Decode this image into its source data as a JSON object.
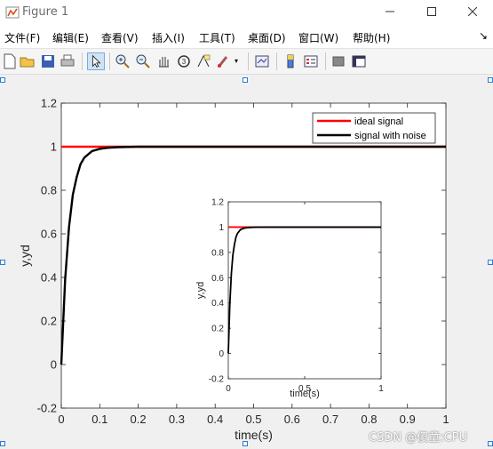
{
  "window": {
    "title": "Figure 1"
  },
  "menu": [
    {
      "label": "文件(F)"
    },
    {
      "label": "编辑(E)"
    },
    {
      "label": "查看(V)"
    },
    {
      "label": "插入(I)"
    },
    {
      "label": "工具(T)"
    },
    {
      "label": "桌面(D)"
    },
    {
      "label": "窗口(W)"
    },
    {
      "label": "帮助(H)"
    }
  ],
  "toolbar_icons": [
    "new-figure-icon",
    "open-file-icon",
    "save-icon",
    "print-icon",
    "select-pointer-icon",
    "zoom-in-icon",
    "zoom-out-icon",
    "pan-hand-icon",
    "rotate-3d-icon",
    "data-cursor-icon",
    "brush-icon",
    "link-plot-icon",
    "colorbar-icon",
    "legend-icon",
    "hide-plot-tools-icon",
    "show-plot-tools-icon"
  ],
  "chart_data": [
    {
      "type": "line",
      "xlabel": "time(s)",
      "ylabel": "y,yd",
      "xlim": [
        0,
        1
      ],
      "ylim": [
        -0.2,
        1.2
      ],
      "xticks": [
        "0",
        "0.1",
        "0.2",
        "0.3",
        "0.4",
        "0.5",
        "0.6",
        "0.7",
        "0.8",
        "0.9",
        "1"
      ],
      "yticks": [
        "-0.2",
        "0",
        "0.2",
        "0.4",
        "0.6",
        "0.8",
        "1",
        "1.2"
      ],
      "grid": false,
      "legend_position": "top-right",
      "series": [
        {
          "name": "ideal signal",
          "color": "#ff0000",
          "x": [
            0,
            1
          ],
          "y": [
            1,
            1
          ]
        },
        {
          "name": "signal with noise",
          "color": "#000000",
          "x": [
            0,
            0.01,
            0.02,
            0.03,
            0.04,
            0.05,
            0.06,
            0.08,
            0.1,
            0.12,
            0.15,
            0.2,
            0.3,
            0.5,
            1
          ],
          "y": [
            0,
            0.39,
            0.63,
            0.78,
            0.86,
            0.92,
            0.95,
            0.98,
            0.99,
            0.995,
            0.998,
            1,
            1,
            1,
            1
          ]
        }
      ]
    },
    {
      "type": "line",
      "xlabel": "time(s)",
      "ylabel": "y,yd",
      "xlim": [
        0,
        1
      ],
      "ylim": [
        -0.2,
        1.2
      ],
      "xticks": [
        "0",
        "0.5",
        "1"
      ],
      "yticks": [
        "-0.2",
        "0",
        "0.2",
        "0.4",
        "0.6",
        "0.8",
        "1",
        "1.2"
      ],
      "grid": false,
      "series": [
        {
          "color": "#ff0000",
          "x": [
            0,
            1
          ],
          "y": [
            1,
            1
          ]
        },
        {
          "color": "#000000",
          "x": [
            0,
            0.01,
            0.02,
            0.03,
            0.04,
            0.05,
            0.06,
            0.08,
            0.1,
            0.12,
            0.15,
            0.2,
            0.3,
            0.5,
            1
          ],
          "y": [
            0,
            0.39,
            0.63,
            0.78,
            0.86,
            0.92,
            0.95,
            0.98,
            0.99,
            0.995,
            0.998,
            1,
            1,
            1,
            1
          ]
        }
      ]
    }
  ],
  "watermark": "CSDN @傻童:CPU"
}
